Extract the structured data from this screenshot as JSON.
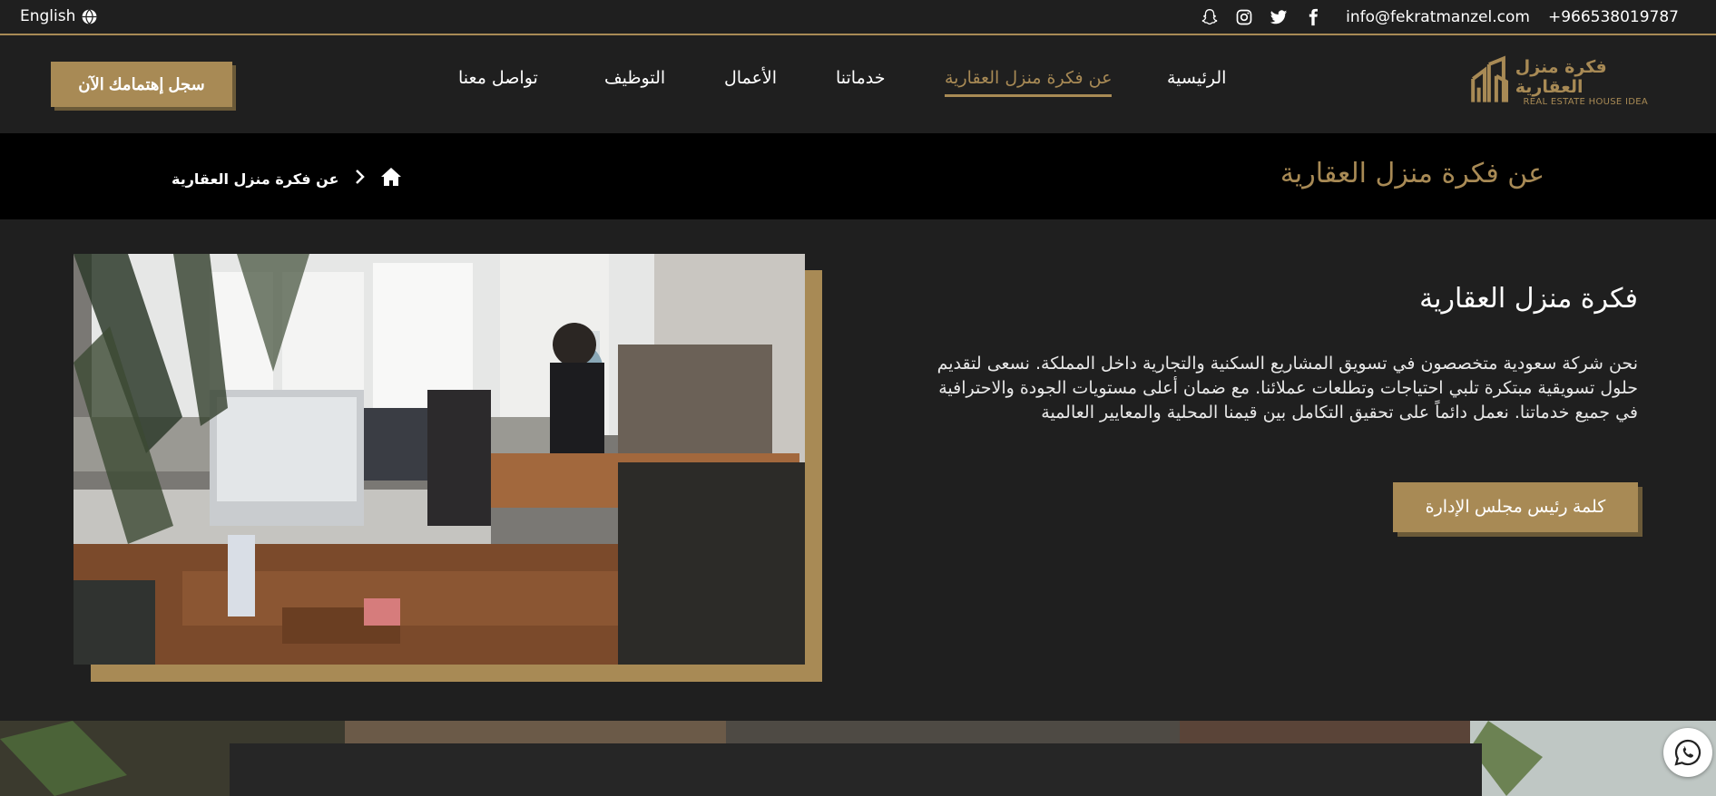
{
  "topbar": {
    "language": "English",
    "email": "info@fekratmanzel.com",
    "phone": "+966538019787",
    "social_icons": [
      "snapchat-icon",
      "instagram-icon",
      "twitter-icon",
      "facebook-icon"
    ]
  },
  "logo": {
    "arabic": "فكرة منزل العقارية",
    "english": "REAL ESTATE HOUSE IDEA"
  },
  "nav": {
    "items": [
      {
        "label": "الرئيسية",
        "active": false
      },
      {
        "label": "عن فكرة منزل العقارية",
        "active": true
      },
      {
        "label": "خدماتنا",
        "active": false
      },
      {
        "label": "الأعمال",
        "active": false
      },
      {
        "label": "التوظيف",
        "active": false
      },
      {
        "label": "تواصل معنا",
        "active": false
      }
    ],
    "cta": "سجل إهتمامك الآن"
  },
  "page_header": {
    "title": "عن فكرة منزل العقارية",
    "breadcrumb_current": "عن فكرة منزل العقارية"
  },
  "about": {
    "title": "فكرة منزل العقارية",
    "body": "نحن شركة سعودية متخصصون في تسويق المشاريع السكنية والتجارية داخل المملكة. نسعى لتقديم حلول تسويقية مبتكرة تلبي احتياجات وتطلعات عملائنا. مع ضمان أعلى مستويات الجودة والاحترافية في جميع خدماتنا. نعمل دائماً على تحقيق التكامل بين قيمنا المحلية والمعايير العالمية",
    "button": "كلمة رئيس مجلس الإدارة"
  },
  "colors": {
    "accent": "#a88a55",
    "background": "#1f1f1f",
    "breadcrumb_bg": "#000000"
  }
}
